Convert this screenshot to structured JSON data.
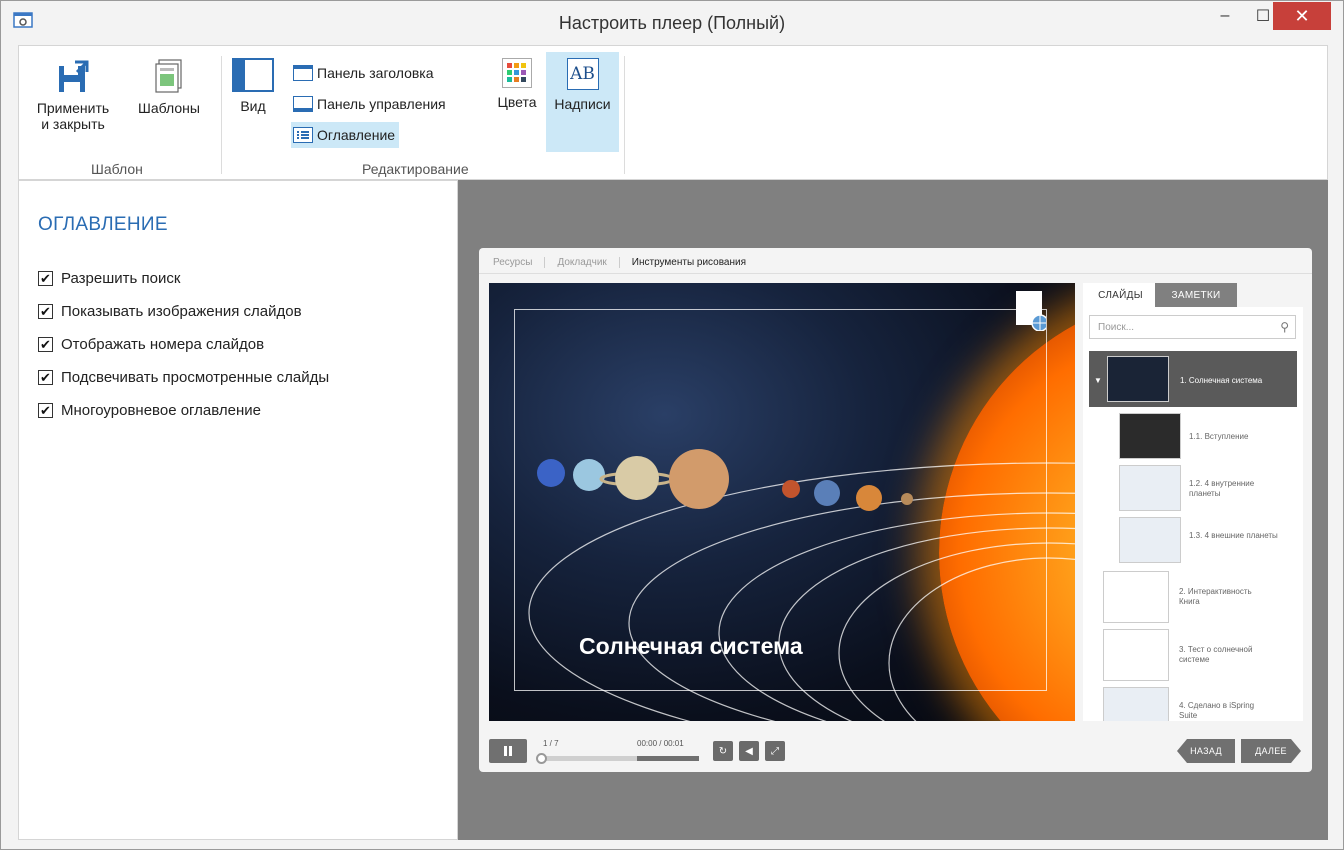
{
  "window": {
    "title": "Настроить плеер (Полный)",
    "minimize": "–",
    "maximize": "☐",
    "close": "✕"
  },
  "ribbon": {
    "apply_label_line1": "Применить",
    "apply_label_line2": "и закрыть",
    "templates_label": "Шаблоны",
    "group1_label": "Шаблон",
    "view_label": "Вид",
    "title_panel_label": "Панель заголовка",
    "control_panel_label": "Панель управления",
    "toc_label": "Оглавление",
    "colors_label": "Цвета",
    "captions_label": "Надписи",
    "captions_icon_text": "AB",
    "group2_label": "Редактирование"
  },
  "panel": {
    "title": "ОГЛАВЛЕНИЕ",
    "options": [
      {
        "label": "Разрешить поиск",
        "checked": true
      },
      {
        "label": "Показывать изображения слайдов",
        "checked": true
      },
      {
        "label": "Отображать номера слайдов",
        "checked": true
      },
      {
        "label": "Подсвечивать просмотренные слайды",
        "checked": true
      },
      {
        "label": "Многоуровневое оглавление",
        "checked": true
      }
    ]
  },
  "player": {
    "top_tabs": [
      "Ресурсы",
      "Докладчик",
      "Инструменты рисования"
    ],
    "slide_title": "Солнечная система",
    "side_tabs": [
      "СЛАЙДЫ",
      "ЗАМЕТКИ"
    ],
    "search_placeholder": "Поиск...",
    "toc": [
      {
        "label": "1. Солнечная система",
        "selected": true
      },
      {
        "label": "1.1. Вступление"
      },
      {
        "label": "1.2. 4 внутренние планеты"
      },
      {
        "label": "1.3. 4 внешние планеты"
      },
      {
        "label": "2. Интерактивность Книга"
      },
      {
        "label": "3. Тест о солнечной системе"
      },
      {
        "label": "4. Сделано в iSpring Suite"
      }
    ],
    "slide_counter": "1 / 7",
    "time": "00:00 / 00:01",
    "back_label": "НАЗАД",
    "next_label": "ДАЛЕЕ"
  },
  "colors": {
    "accent": "#2a6cb3",
    "selection": "#cce8f7",
    "close_red": "#c7403a"
  }
}
